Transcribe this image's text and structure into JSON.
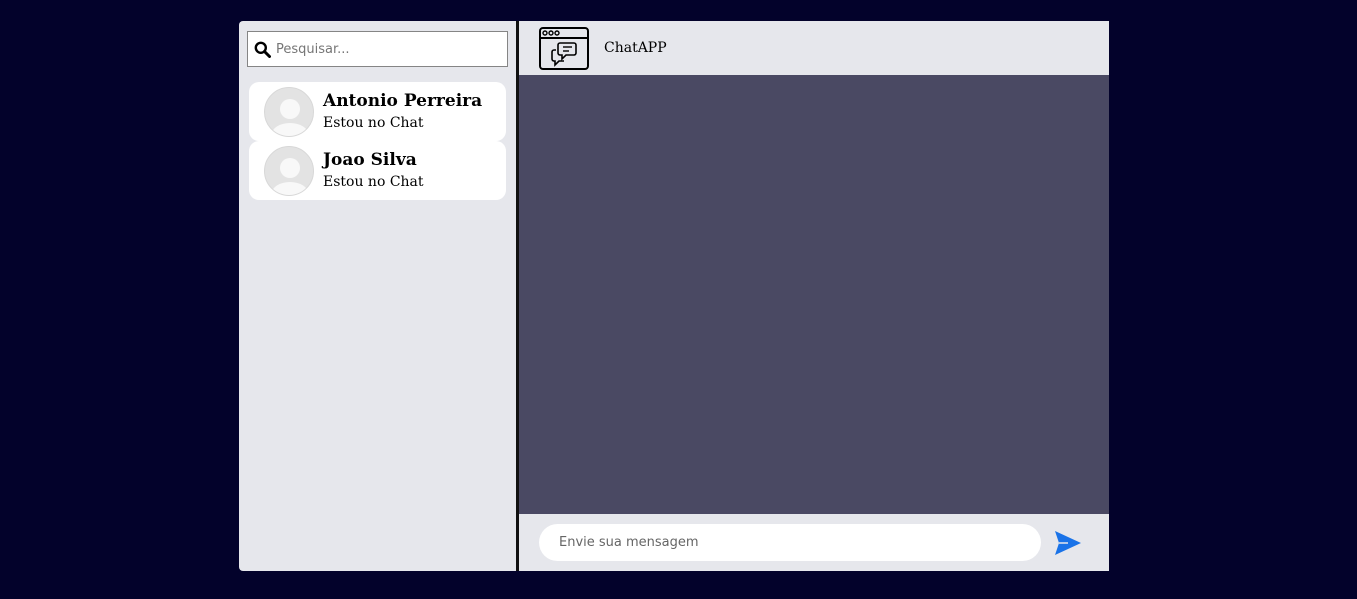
{
  "search": {
    "placeholder": "Pesquisar..."
  },
  "contacts": [
    {
      "name": "Antonio Perreira",
      "status": "Estou no Chat"
    },
    {
      "name": "Joao Silva",
      "status": "Estou no Chat"
    }
  ],
  "header": {
    "title": "ChatAPP",
    "logo_icon": "chat-window-icon"
  },
  "composer": {
    "placeholder": "Envie sua mensagem",
    "value": "",
    "send_icon": "send-icon"
  },
  "colors": {
    "background": "#03022b",
    "panel": "#e6e7ec",
    "messages_area": "#4a4963",
    "send_accent": "#1a73e8"
  }
}
